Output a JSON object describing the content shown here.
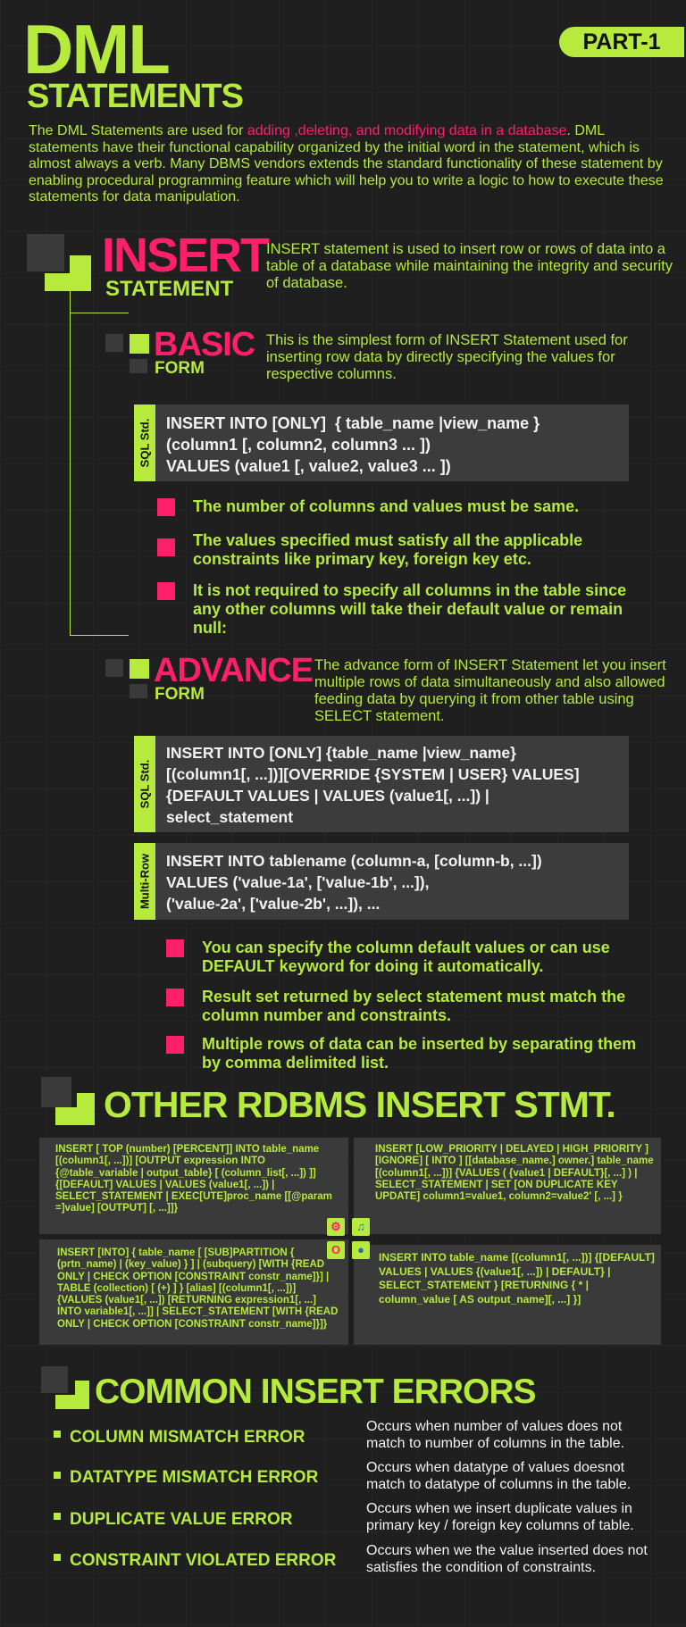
{
  "header": {
    "title_line1": "DML",
    "title_line2": "STATEMENTS",
    "badge": "PART-1",
    "intro_before": "The DML Statements are used for ",
    "intro_highlight": "adding ,deleting, and modifying data in a database",
    "intro_after": ". DML statements have their functional capability organized by the initial word in the statement, which is almost always a verb.  Many DBMS vendors extends the standard functionality of these statement by enabling procedural programming feature which will help you to write a logic to how to execute these statements for data manipulation."
  },
  "insert": {
    "title": "INSERT",
    "subtitle": "STATEMENT",
    "description": "INSERT statement is used to insert row or rows of data into a table of a database while maintaining the integrity and security of database."
  },
  "basic": {
    "title": "BASIC",
    "subtitle": "FORM",
    "description": "This is the simplest form of INSERT Statement used for inserting row data by directly specifying the values for respective columns.",
    "tag": "SQL Std.",
    "code": "INSERT INTO [ONLY]  { table_name |view_name }\n(column1 [, column2, column3 ... ])\nVALUES (value1 [, value2, value3 ... ])",
    "bullets": [
      "The number of columns and values must be same.",
      "The values specified must satisfy all the applicable constraints like primary key, foreign key etc.",
      "It is not required to specify all columns in the table since any other columns will take their default value or remain null:"
    ]
  },
  "advance": {
    "title": "ADVANCE",
    "subtitle": "FORM",
    "description": "The advance form of INSERT Statement let you insert multiple rows of data simultaneously and also allowed feeding data by querying it from other table using SELECT statement.",
    "tag1": "SQL Std.",
    "code1": "INSERT INTO [ONLY] {table_name |view_name}\n[(column1[, ...])][OVERRIDE {SYSTEM | USER} VALUES]\n{DEFAULT VALUES | VALUES (value1[, ...]) |\nselect_statement",
    "tag2": "Multi-Row",
    "code2": "INSERT INTO tablename (column-a, [column-b, ...])\nVALUES ('value-1a', ['value-1b', ...]),\n('value-2a', ['value-2b', ...]), ...",
    "bullets": [
      "You can specify the column default values or can use DEFAULT keyword for doing it automatically.",
      "Result set returned by select statement must match the column number and constraints.",
      "Multiple rows of data can be inserted by separating them by comma delimited list."
    ]
  },
  "other": {
    "title": "OTHER RDBMS INSERT STMT.",
    "sqlserver": "INSERT [ TOP (number) [PERCENT]]  INTO table_name [(column1[, ...])] [OUTPUT expression INTO {@table_variable | output_table} [ (column_list[, ...]) ]] {[DEFAULT] VALUES | VALUES (value1[, ...]) | SELECT_STATEMENT | EXEC[UTE]proc_name [[@param =]value] [OUTPUT] [, ...]]}",
    "mysql": "INSERT [LOW_PRIORITY | DELAYED | HIGH_PRIORITY ] [IGNORE] [ INTO ] [[database_name.] owner.] table_name [(column1[, ...])] {VALUES ( {value1 | DEFAULT}[, ...] ) | SELECT_STATEMENT | SET [ON DUPLICATE KEY UPDATE] column1=value1, column2=value2' [, ...] }",
    "oracle": "INSERT [INTO] { table_name [ [SUB]PARTITION  { (prtn_name) | (key_value) } ] | (subquery) [WITH {READ ONLY  | CHECK OPTION [CONSTRAINT constr_name]}] |  TABLE (collection) [ (+) ] } [alias]  [(column1[, ...])] {VALUES (value1[, ...]) [RETURNING expression1[, ...]  INTO variable1[, ...]] | SELECT_STATEMENT [WITH {READ ONLY |  CHECK OPTION [CONSTRAINT constr_name]}]}",
    "postgresql": "INSERT INTO table_name [(column1[, ...])] {[DEFAULT] VALUES | VALUES {(value1[, ...]) | DEFAULT} | SELECT_STATEMENT } [RETURNING { * | column_value [ AS output_name][, ...] }]"
  },
  "errors": {
    "title": "COMMON INSERT ERRORS",
    "items": [
      {
        "label": "COLUMN MISMATCH ERROR",
        "desc": "Occurs when number of values does not match to number of columns in the table."
      },
      {
        "label": "DATATYPE MISMATCH ERROR",
        "desc": "Occurs when datatype of values doesnot match to datatype of columns in the table."
      },
      {
        "label": "DUPLICATE VALUE ERROR",
        "desc": "Occurs when we insert duplicate values in primary key / foreign key columns of table."
      },
      {
        "label": "CONSTRAINT VIOLATED ERROR",
        "desc": "Occurs when we the value inserted does not satisfies the condition of constraints."
      }
    ]
  },
  "colors": {
    "lime": "#b6ea3c",
    "pink": "#ff1f6b",
    "background": "#1f1f1f",
    "code_box": "#3c3c3c"
  }
}
